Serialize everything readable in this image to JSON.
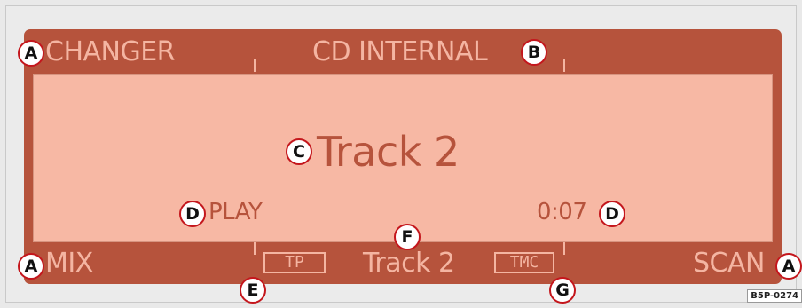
{
  "display": {
    "top_left": "CHANGER",
    "top_center": "CD INTERNAL",
    "main_title": "Track 2",
    "status_left": "PLAY",
    "status_right": "0:07",
    "bottom_left": "MIX",
    "bottom_tp": "TP",
    "bottom_center": "Track 2",
    "bottom_tmc": "TMC",
    "bottom_right": "SCAN"
  },
  "callouts": {
    "a": "A",
    "b": "B",
    "c": "C",
    "d": "D",
    "e": "E",
    "f": "F",
    "g": "G"
  },
  "figure_code": "B5P-0274",
  "colors": {
    "frame": "#b6533c",
    "screen": "#f7b8a4",
    "callout_ring": "#c4161c"
  }
}
